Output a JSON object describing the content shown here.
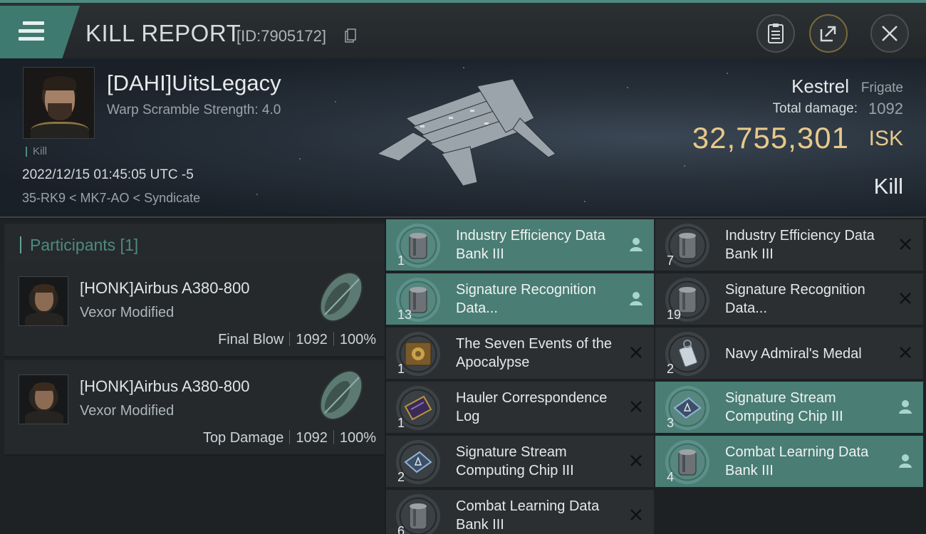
{
  "header": {
    "title": "KILL REPORT",
    "report_id": "[ID:7905172]"
  },
  "victim": {
    "name": "[DAHI]UitsLegacy",
    "subtitle": "Warp Scramble Strength: 4.0",
    "tag": "Kill",
    "date": "2022/12/15 01:45:05 UTC -5",
    "location": "35-RK9 < MK7-AO < Syndicate",
    "ship_name": "Kestrel",
    "ship_class": "Frigate",
    "total_damage_label": "Total damage:",
    "total_damage": "1092",
    "isk_value": "32,755,301",
    "isk_unit": "ISK",
    "result": "Kill"
  },
  "participants": {
    "heading": "Participants [1]",
    "rows": [
      {
        "name": "[HONK]Airbus A380-800",
        "ship": "Vexor Modified",
        "role": "Final Blow",
        "damage": "1092",
        "percent": "100%"
      },
      {
        "name": "[HONK]Airbus A380-800",
        "ship": "Vexor Modified",
        "role": "Top Damage",
        "damage": "1092",
        "percent": "100%"
      }
    ]
  },
  "items": {
    "left": [
      {
        "qty": "1",
        "label": "Industry Efficiency Data Bank III",
        "icon": "data-bank-icon",
        "status": "dropped"
      },
      {
        "qty": "13",
        "label": "Signature Recognition Data...",
        "icon": "data-bank-icon",
        "status": "dropped"
      },
      {
        "qty": "1",
        "label": "The Seven Events of the Apocalypse",
        "icon": "book-icon",
        "status": "destroyed"
      },
      {
        "qty": "1",
        "label": "Hauler Correspondence Log",
        "icon": "log-icon",
        "status": "destroyed"
      },
      {
        "qty": "2",
        "label": "Signature Stream Computing Chip III",
        "icon": "chip-icon",
        "status": "destroyed"
      },
      {
        "qty": "6",
        "label": "Combat Learning Data Bank III",
        "icon": "data-bank-icon",
        "status": "destroyed"
      }
    ],
    "right": [
      {
        "qty": "7",
        "label": "Industry Efficiency Data Bank III",
        "icon": "data-bank-icon",
        "status": "destroyed"
      },
      {
        "qty": "19",
        "label": "Signature Recognition Data...",
        "icon": "data-bank-icon",
        "status": "destroyed"
      },
      {
        "qty": "2",
        "label": "Navy Admiral's Medal",
        "icon": "medal-icon",
        "status": "destroyed"
      },
      {
        "qty": "3",
        "label": "Signature Stream Computing Chip III",
        "icon": "chip-icon",
        "status": "dropped"
      },
      {
        "qty": "4",
        "label": "Combat Learning Data Bank III",
        "icon": "data-bank-icon",
        "status": "dropped"
      }
    ]
  },
  "colors": {
    "accent": "#4e8a80",
    "dropped_row": "#4a7d74",
    "isk": "#e8c98a"
  }
}
